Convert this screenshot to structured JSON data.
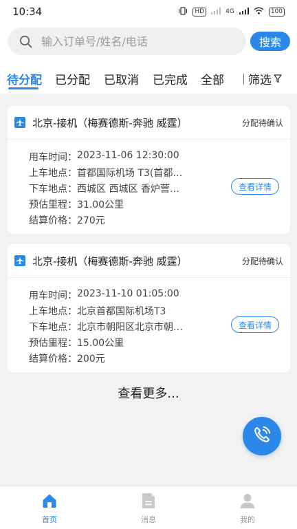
{
  "status_bar": {
    "time": "10:34",
    "hd_label": "HD",
    "network": "4G",
    "battery": "100"
  },
  "search": {
    "placeholder": "输入订单号/姓名/电话",
    "button_label": "搜索"
  },
  "tabs": [
    {
      "label": "待分配",
      "active": true
    },
    {
      "label": "已分配",
      "active": false
    },
    {
      "label": "已取消",
      "active": false
    },
    {
      "label": "已完成",
      "active": false
    },
    {
      "label": "全部",
      "active": false
    }
  ],
  "filter_label": "筛选",
  "orders": [
    {
      "title": "北京-接机（梅赛德斯-奔驰 威霆）",
      "status": "分配待确认",
      "time_label": "用车时间：",
      "time": "2023-11-06 12:30:00",
      "pickup_label": "上车地点：",
      "pickup": "首都国际机场 T3(首都…",
      "dropoff_label": "下车地点：",
      "dropoff": "西城区 西城区 香炉营…",
      "distance_label": "预估里程：",
      "distance": "31.00公里",
      "price_label": "结算价格：",
      "price": "270元",
      "detail_button": "查看详情"
    },
    {
      "title": "北京-接机（梅赛德斯-奔驰 威霆）",
      "status": "分配待确认",
      "time_label": "用车时间：",
      "time": "2023-11-10 01:05:00",
      "pickup_label": "上车地点：",
      "pickup": "北京首都国际机场T3",
      "dropoff_label": "下车地点：",
      "dropoff": "北京市朝阳区北京市朝…",
      "distance_label": "预估里程：",
      "distance": "15.00公里",
      "price_label": "结算价格：",
      "price": "200元",
      "detail_button": "查看详情"
    }
  ],
  "load_more": "查看更多...",
  "fab_icon": "phone-icon",
  "bottom_nav": [
    {
      "label": "首页",
      "icon": "home-icon",
      "active": true
    },
    {
      "label": "消息",
      "icon": "message-icon",
      "active": false
    },
    {
      "label": "我的",
      "icon": "profile-icon",
      "active": false
    }
  ],
  "colors": {
    "accent": "#2b87e8",
    "background": "#f2f2f2"
  }
}
